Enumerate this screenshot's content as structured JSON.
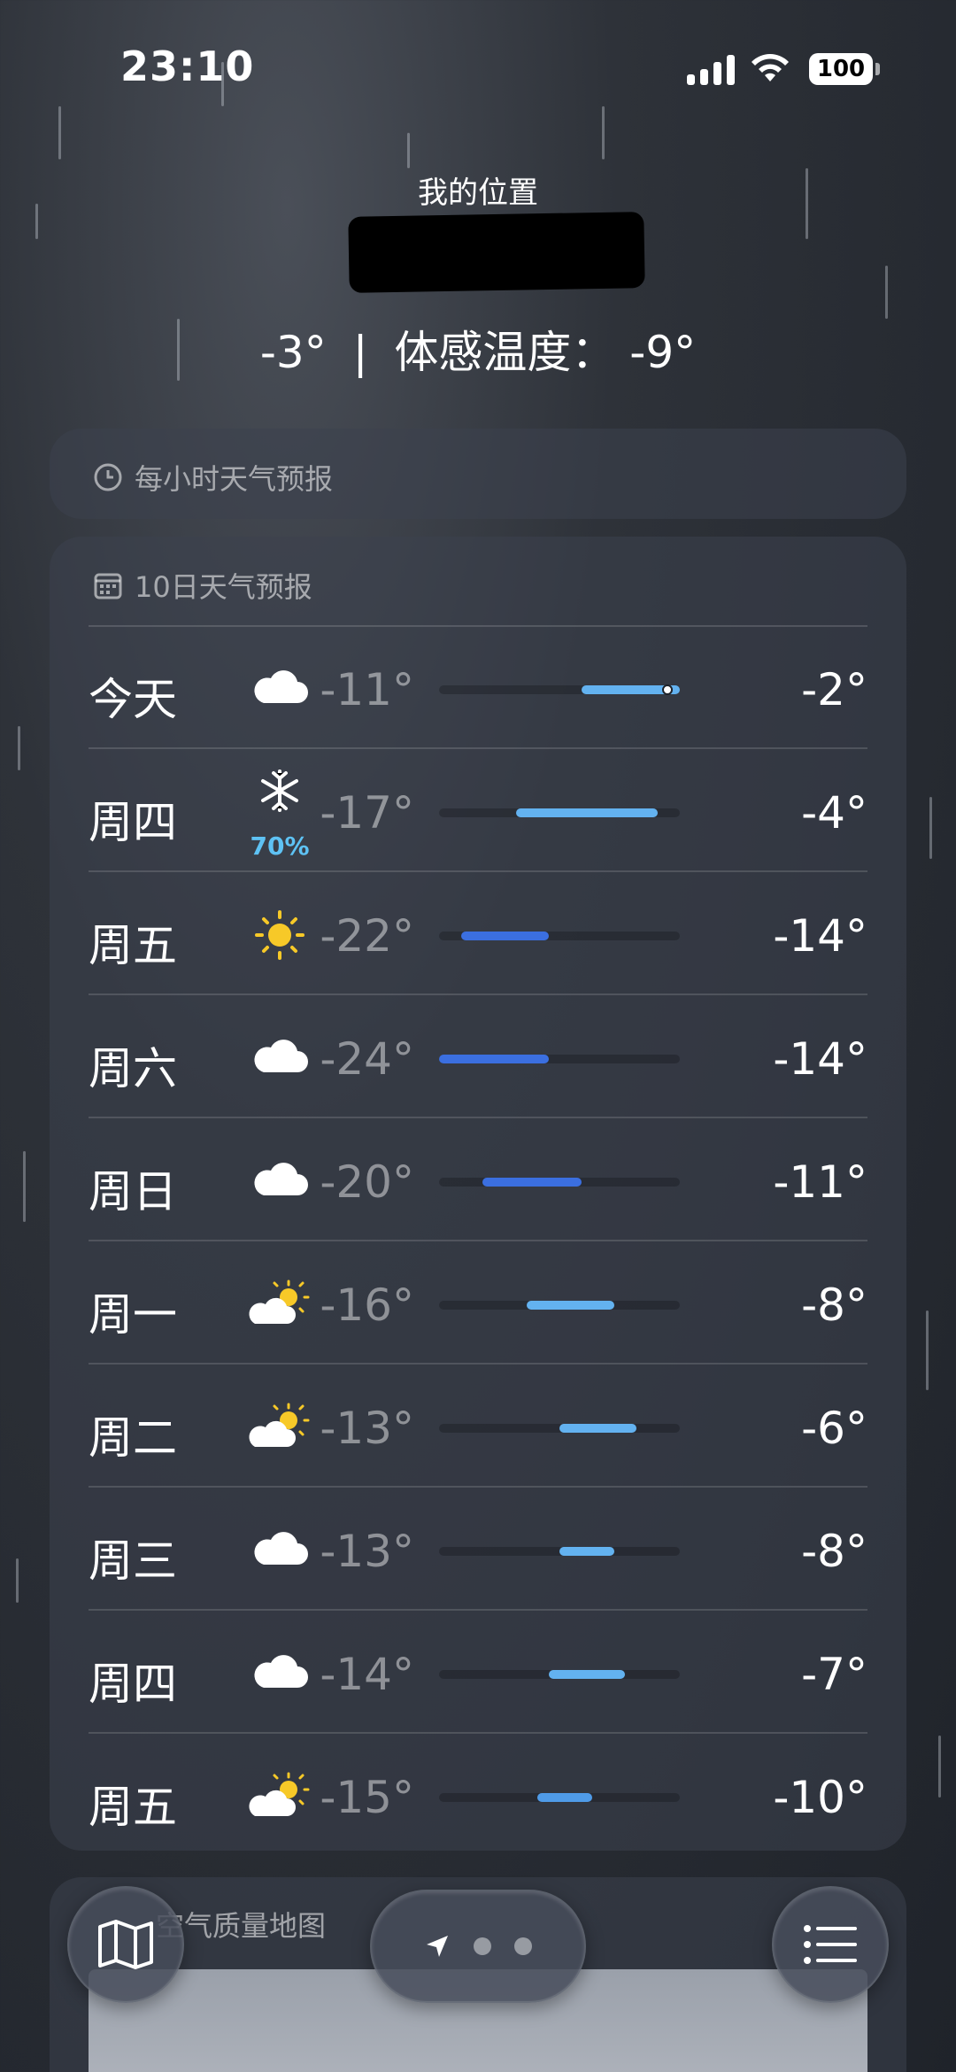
{
  "status_bar": {
    "time": "23:10",
    "battery": "100"
  },
  "header": {
    "location_label": "我的位置",
    "current_temp": "-3°",
    "separator": "|",
    "feels_like_label": "体感温度：",
    "feels_like": "-9°"
  },
  "hourly": {
    "title": "每小时天气预报",
    "icon": "clock-icon"
  },
  "ten_day": {
    "title": "10日天气预报",
    "icon": "calendar-icon",
    "colors": {
      "low_bar": "#3b6fe0",
      "mid_bar": "#4f9be8",
      "high_bar": "#63b2f0",
      "track": "#1f232a",
      "precip": "#5ec2f4"
    },
    "scale": {
      "min": -24,
      "max": -2
    },
    "current": -3,
    "days": [
      {
        "day": "今天",
        "icon": "cloud-icon",
        "precip": "",
        "low": "-11°",
        "high": "-2°",
        "low_v": -11,
        "high_v": -2
      },
      {
        "day": "周四",
        "icon": "snowflake-icon",
        "precip": "70%",
        "low": "-17°",
        "high": "-4°",
        "low_v": -17,
        "high_v": -4
      },
      {
        "day": "周五",
        "icon": "sun-icon",
        "precip": "",
        "low": "-22°",
        "high": "-14°",
        "low_v": -22,
        "high_v": -14
      },
      {
        "day": "周六",
        "icon": "cloud-icon",
        "precip": "",
        "low": "-24°",
        "high": "-14°",
        "low_v": -24,
        "high_v": -14
      },
      {
        "day": "周日",
        "icon": "cloud-icon",
        "precip": "",
        "low": "-20°",
        "high": "-11°",
        "low_v": -20,
        "high_v": -11
      },
      {
        "day": "周一",
        "icon": "partly-sunny-icon",
        "precip": "",
        "low": "-16°",
        "high": "-8°",
        "low_v": -16,
        "high_v": -8
      },
      {
        "day": "周二",
        "icon": "partly-sunny-icon",
        "precip": "",
        "low": "-13°",
        "high": "-6°",
        "low_v": -13,
        "high_v": -6
      },
      {
        "day": "周三",
        "icon": "cloud-icon",
        "precip": "",
        "low": "-13°",
        "high": "-8°",
        "low_v": -13,
        "high_v": -8
      },
      {
        "day": "周四",
        "icon": "cloud-icon",
        "precip": "",
        "low": "-14°",
        "high": "-7°",
        "low_v": -14,
        "high_v": -7
      },
      {
        "day": "周五",
        "icon": "partly-sunny-icon",
        "precip": "",
        "low": "-15°",
        "high": "-10°",
        "low_v": -15,
        "high_v": -10
      }
    ]
  },
  "air_quality": {
    "title": "空气质量地图"
  },
  "toolbar": {
    "map_icon": "map-icon",
    "location_icon": "location-arrow-icon",
    "list_icon": "list-icon"
  }
}
